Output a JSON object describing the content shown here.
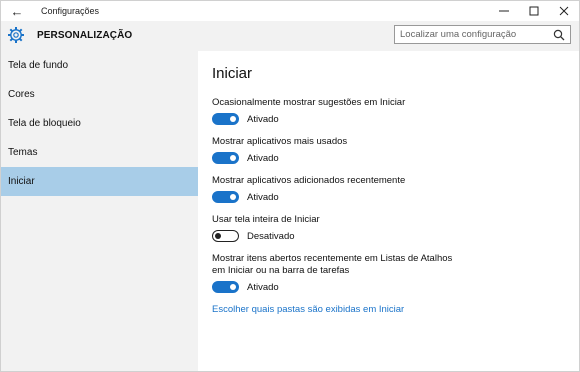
{
  "window": {
    "title": "Configurações",
    "back_icon": "arrow-left-icon",
    "controls": [
      "minimize-icon",
      "maximize-icon",
      "close-icon"
    ]
  },
  "header": {
    "icon": "gear-icon",
    "title": "PERSONALIZAÇÃO",
    "search_placeholder": "Localizar uma configuração",
    "search_value": ""
  },
  "sidebar": {
    "items": [
      {
        "label": "Tela de fundo",
        "active": false
      },
      {
        "label": "Cores",
        "active": false
      },
      {
        "label": "Tela de bloqueio",
        "active": false
      },
      {
        "label": "Temas",
        "active": false
      },
      {
        "label": "Iniciar",
        "active": true
      }
    ]
  },
  "main": {
    "title": "Iniciar",
    "settings": [
      {
        "label": "Ocasionalmente mostrar sugestões em Iniciar",
        "state": "Ativado",
        "on": true
      },
      {
        "label": "Mostrar aplicativos mais usados",
        "state": "Ativado",
        "on": true
      },
      {
        "label": "Mostrar aplicativos adicionados recentemente",
        "state": "Ativado",
        "on": true
      },
      {
        "label": "Usar tela inteira de Iniciar",
        "state": "Desativado",
        "on": false
      },
      {
        "label": "Mostrar itens abertos recentemente em Listas de Atalhos em Iniciar ou na barra de tarefas",
        "state": "Ativado",
        "on": true
      }
    ],
    "link": "Escolher quais pastas são exibidas em Iniciar"
  },
  "colors": {
    "accent": "#1a73c9",
    "sidebar_bg": "#f2f2f2",
    "selected_bg": "#a8cde8"
  }
}
